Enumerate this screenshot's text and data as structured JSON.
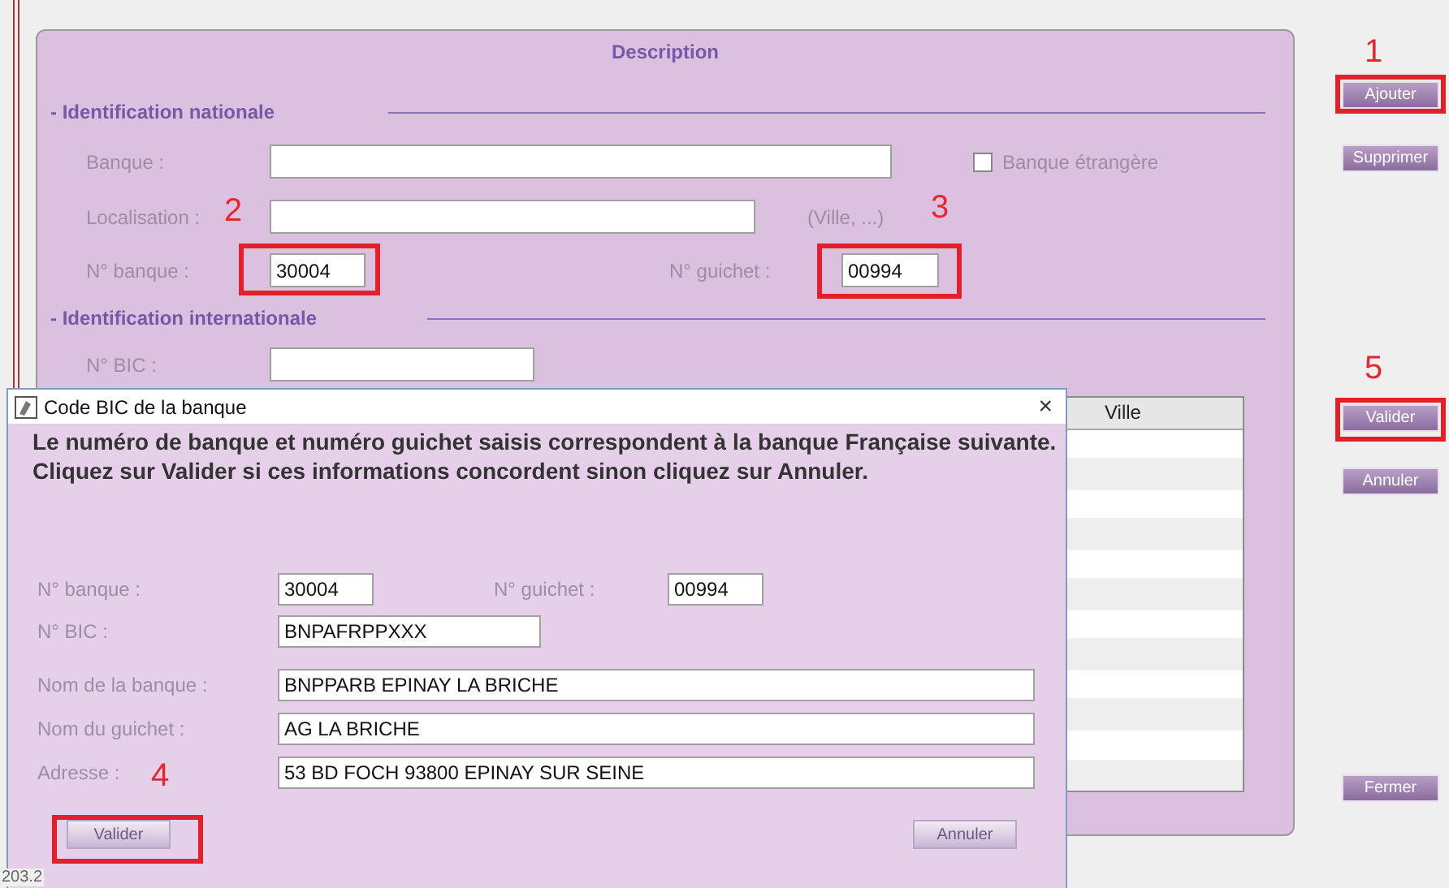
{
  "panel": {
    "title": "Description"
  },
  "national": {
    "heading": "- Identification nationale",
    "bank_name": {
      "label": "Banque :"
    },
    "foreign_bank": {
      "label": "Banque étrangère",
      "checked": false
    },
    "location": {
      "label": "Localisation :",
      "hint": "(Ville, ...)"
    },
    "bank_code": {
      "label": "N° banque :",
      "value": "30004"
    },
    "branch_code": {
      "label": "N° guichet :",
      "value": "00994"
    }
  },
  "international": {
    "heading": "- Identification internationale",
    "bic": {
      "label": "N° BIC :"
    }
  },
  "table": {
    "columns": [
      "Ville"
    ]
  },
  "side_buttons": [
    "Ajouter",
    "Supprimer",
    "Valider",
    "Annuler",
    "Fermer"
  ],
  "dialog": {
    "title": "Code BIC de la banque",
    "close": "×",
    "message": [
      "Le numéro de banque et numéro guichet saisis correspondent à la banque Française suivante.",
      "Cliquez sur Valider si ces informations concordent sinon cliquez sur Annuler."
    ],
    "fields": [
      {
        "label": "N° banque :",
        "value": "30004"
      },
      {
        "label": "N° guichet :",
        "value": "00994"
      },
      {
        "label": "N° BIC :",
        "value": "BNPAFRPPXXX"
      },
      {
        "label": "Nom de la banque :",
        "value": "BNPPARB EPINAY LA BRICHE"
      },
      {
        "label": "Nom du guichet :",
        "value": "AG LA BRICHE"
      },
      {
        "label": "Adresse :",
        "value": "53 BD FOCH 93800 EPINAY SUR SEINE"
      }
    ],
    "buttons": [
      "Valider",
      "Annuler"
    ]
  },
  "version": "203.2",
  "annotations": [
    "1",
    "2",
    "3",
    "4",
    "5"
  ]
}
